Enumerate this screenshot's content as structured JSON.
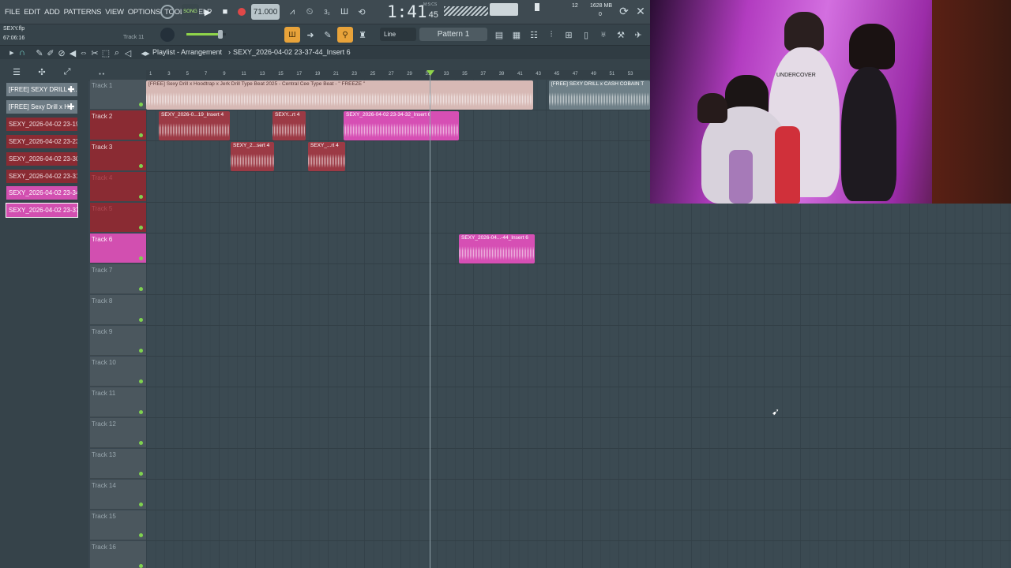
{
  "menu": [
    "FILE",
    "EDIT",
    "ADD",
    "PATTERNS",
    "VIEW",
    "OPTIONS",
    "TOOLS",
    "HELP"
  ],
  "transport": {
    "song_label": "SONG",
    "tempo": "71.000",
    "time": "1:41",
    "time_sub": "45",
    "time_unit": "M:S:CS",
    "cpu_value": "12",
    "memory": "1628 MB",
    "voices": "0"
  },
  "project": {
    "file": "SEXY.flp",
    "time": "67:06:16",
    "hint": "Track 11"
  },
  "toolbar": {
    "snap": "Line",
    "pattern": "Pattern 1"
  },
  "playlist": {
    "title": "Playlist - Arrangement",
    "breadcrumb": "SEXY_2026-04-02 23-37-44_Insert 6"
  },
  "ruler": [
    "1",
    "3",
    "5",
    "7",
    "9",
    "11",
    "13",
    "15",
    "17",
    "19",
    "21",
    "23",
    "25",
    "27",
    "29",
    "31",
    "33",
    "35",
    "37",
    "39",
    "41",
    "43",
    "45",
    "47",
    "49",
    "51",
    "53"
  ],
  "browser_items": [
    "[FREE] SEXY DRILL x...",
    "[FREE] Sexy Drill x H...",
    "SEXY_2026-04-02 23-19...",
    "SEXY_2026-04-02 23-23...",
    "SEXY_2026-04-02 23-30...",
    "SEXY_2026-04-02 23-31...",
    "SEXY_2026-04-02 23-34...",
    "SEXY_2026-04-02 23-37..."
  ],
  "tracks": [
    "Track 1",
    "Track 2",
    "Track 3",
    "Track 4",
    "Track 5",
    "Track 6",
    "Track 7",
    "Track 8",
    "Track 9",
    "Track 10",
    "Track 11",
    "Track 12",
    "Track 13",
    "Track 14",
    "Track 15",
    "Track 16"
  ],
  "clips": [
    {
      "label": "[FREE] Sexy Drill x Hoodtrap x Jerk Drill Type Beat 2025 - Central Cee Type Beat - \" FREEZE \"",
      "color": "#d7b9b5"
    },
    {
      "label": "[FREE] SEXY DRILL x CASH COBAIN T",
      "color": "#6f8088"
    },
    {
      "label": "SEXY_2026-0...19_Insert 4",
      "color": "#9c3a45"
    },
    {
      "label": "SEXY...rt 4",
      "color": "#9c3a45"
    },
    {
      "label": "SEXY_2026-04-02 23-34-32_Insert 6",
      "color": "#d64fb4"
    },
    {
      "label": "SEXY_2...sert 4",
      "color": "#9c3a45"
    },
    {
      "label": "SEXY_...rt 4",
      "color": "#9c3a45"
    },
    {
      "label": "SEXY_2026-04...-44_Insert 6",
      "color": "#d64fb4"
    }
  ],
  "webcam": {
    "shirt_text": "UNDERCOVER"
  }
}
